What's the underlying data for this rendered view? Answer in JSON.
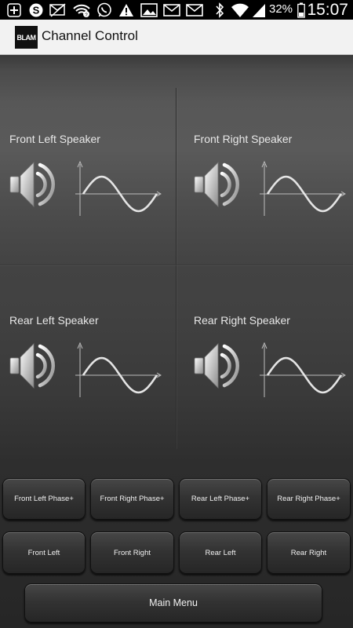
{
  "status_bar": {
    "left_icons": [
      "add-icon",
      "skype-icon",
      "mail-muted-icon",
      "wifi-question-icon",
      "whatsapp-icon",
      "warning-icon",
      "image-icon",
      "mail-icon",
      "mail-icon"
    ],
    "right_icons": [
      "bluetooth-icon",
      "wifi-icon",
      "signal-icon",
      "battery-icon"
    ],
    "battery": "32%",
    "time": "15:07"
  },
  "app": {
    "logo_text": "BLAM",
    "title": "Channel Control"
  },
  "speakers": [
    {
      "name": "Front Left Speaker"
    },
    {
      "name": "Front Right Speaker"
    },
    {
      "name": "Rear Left Speaker"
    },
    {
      "name": "Rear Right Speaker"
    }
  ],
  "phase_buttons": [
    {
      "label": "Front Left Phase+"
    },
    {
      "label": "Front Right Phase+"
    },
    {
      "label": "Rear Left Phase+"
    },
    {
      "label": "Rear Right Phase+"
    }
  ],
  "channel_buttons": [
    {
      "label": "Front Left"
    },
    {
      "label": "Front Right"
    },
    {
      "label": "Rear Left"
    },
    {
      "label": "Rear Right"
    }
  ],
  "main_menu": {
    "label": "Main Menu"
  },
  "colors": {
    "status_bar": "#000000",
    "action_bar": "#f2f2f2",
    "button_text": "#f0f0f0"
  }
}
